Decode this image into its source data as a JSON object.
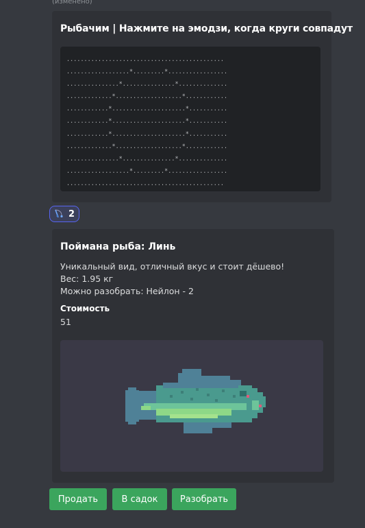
{
  "header": {
    "edited_label": "(изменено)"
  },
  "game_embed": {
    "title": "Рыбачим | Нажмите на эмодзи, когда круги совпадут",
    "grid": [
      ".............................................",
      "..................*.........*.................",
      "...............*...............*..............",
      ".............*...................*............",
      "............*.....................*...........",
      "............*.....................*...........",
      "............*.....................*...........",
      ".............*...................*............",
      "...............*...............*..............",
      "..................*.........*.................",
      "............................................."
    ]
  },
  "reaction": {
    "icon": "fishing-rod-emoji",
    "count": "2"
  },
  "catch_embed": {
    "title": "Поймана рыба: Линь",
    "description": [
      "Уникальный вид, отличный вкус и стоит дёшево!",
      "Вес: 1.95 кг",
      "Можно разобрать: Нейлон - 2"
    ],
    "field_name": "Стоимость",
    "field_value": "51",
    "image": "tench-fish"
  },
  "buttons": {
    "sell": "Продать",
    "keep": "В садок",
    "disassemble": "Разобрать"
  },
  "colors": {
    "button": "#3ba55d",
    "reaction_border": "#5865f2",
    "embed_bg": "#2f3136",
    "code_bg": "#202225"
  }
}
